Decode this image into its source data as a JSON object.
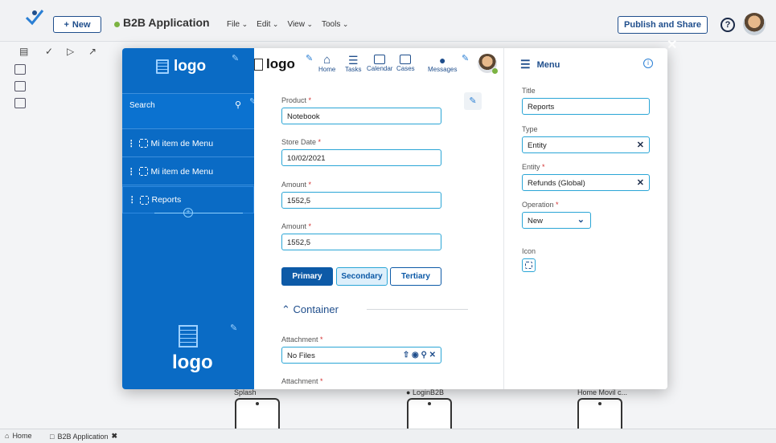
{
  "topbar": {
    "new_label": "New",
    "app_name": "B2B Application",
    "menus": [
      "File",
      "Edit",
      "View",
      "Tools"
    ],
    "publish_label": "Publish and Share",
    "help_symbol": "?",
    "colors": {
      "primary": "#1f4e8c",
      "app_status": "#7cb342"
    }
  },
  "canvas": {
    "labels": [
      "Splash",
      "LoginB2B",
      "Home Movil c..."
    ]
  },
  "sidebar": {
    "logo_text": "logo",
    "search_label": "Search",
    "items": [
      {
        "label": "Mi item de Menu"
      },
      {
        "label": "Mi item de Menu"
      },
      {
        "label": "Reports"
      }
    ],
    "footer_logo_text": "logo",
    "color": "#0a6bc5"
  },
  "header": {
    "logo_text": "logo",
    "nav": [
      "Home",
      "Tasks",
      "Calendar",
      "Cases",
      "Messages"
    ]
  },
  "form": {
    "fields": [
      {
        "label": "Product",
        "value": "Notebook"
      },
      {
        "label": "Store Date",
        "value": "10/02/2021"
      },
      {
        "label": "Amount",
        "value": "1552,5"
      },
      {
        "label": "Amount",
        "value": "1552,5"
      }
    ],
    "buttons": {
      "primary": "Primary",
      "secondary": "Secondary",
      "tertiary": "Tertiary"
    },
    "container_label": "Container",
    "attachment": {
      "label": "Attachment",
      "value": "No Files"
    },
    "attachment2_label": "Attachment"
  },
  "menu_panel": {
    "heading": "Menu",
    "title_label": "Title",
    "title_value": "Reports",
    "type_label": "Type",
    "type_value": "Entity",
    "entity_label": "Entity",
    "entity_value": "Refunds (Global)",
    "operation_label": "Operation",
    "operation_value": "New",
    "icon_label": "Icon"
  },
  "bottom_tabs": [
    {
      "label": "Home"
    },
    {
      "label": "B2B Application"
    }
  ]
}
